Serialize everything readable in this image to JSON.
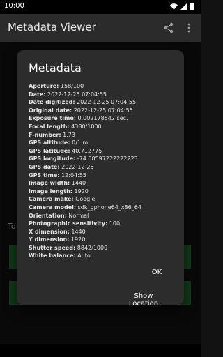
{
  "status_bar": {
    "time": "10:00"
  },
  "app_bar": {
    "title": "Metadata Viewer",
    "share_icon": "share-icon",
    "more_icon": "more-vert-icon"
  },
  "background": {
    "text": "To"
  },
  "dialog": {
    "title": "Metadata",
    "rows": [
      {
        "key": "Aperture:",
        "value": "158/100"
      },
      {
        "key": "Date:",
        "value": "2022-12-25 07:04:55"
      },
      {
        "key": "Date digitized:",
        "value": "2022-12-25 07:04:55"
      },
      {
        "key": "Original date:",
        "value": "2022-12-25 07:04:55"
      },
      {
        "key": "Exposure time:",
        "value": "0.002178542 sec."
      },
      {
        "key": "Focal length:",
        "value": "4380/1000"
      },
      {
        "key": "F-number:",
        "value": "1.73"
      },
      {
        "key": "GPS altitude:",
        "value": "0/1 m"
      },
      {
        "key": "GPS latitude:",
        "value": "40.712775"
      },
      {
        "key": "GPS longitude:",
        "value": "-74.00597222222223"
      },
      {
        "key": "GPS date:",
        "value": "2022-12-25"
      },
      {
        "key": "GPS time:",
        "value": "12:04:55"
      },
      {
        "key": "Image width:",
        "value": "1440"
      },
      {
        "key": "Image length:",
        "value": "1920"
      },
      {
        "key": "Camera make:",
        "value": "Google"
      },
      {
        "key": "Camera model:",
        "value": "sdk_gphone64_x86_64"
      },
      {
        "key": "Orientation:",
        "value": "Normal"
      },
      {
        "key": "Photographic sensitivity:",
        "value": "100"
      },
      {
        "key": "X dimension:",
        "value": "1440"
      },
      {
        "key": "Y dimension:",
        "value": "1920"
      },
      {
        "key": "Shutter speed:",
        "value": "8842/1000"
      },
      {
        "key": "White balance:",
        "value": "Auto"
      }
    ],
    "ok_label": "OK",
    "show_location_label": "Show Location"
  },
  "colors": {
    "accent_green": "#1f6b2a",
    "dialog_bg": "#2c2c2c",
    "app_bar_bg": "#2b2b2b"
  }
}
